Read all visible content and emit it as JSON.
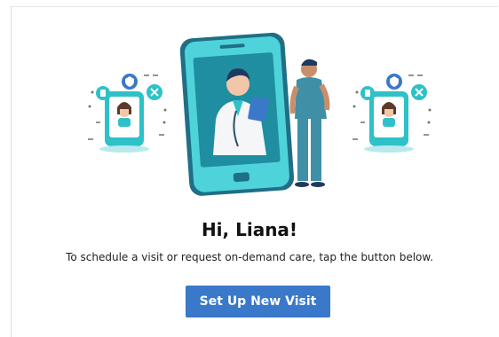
{
  "greeting": "Hi, Liana!",
  "subtitle": "To schedule a visit or request on-demand care, tap the button below.",
  "cta_label": "Set Up New Visit",
  "colors": {
    "accent": "#3a78c9",
    "teal": "#2ec1c8",
    "phone_dark": "#1f6f86",
    "screen": "#2bb8c4"
  },
  "icons": [
    "shield-icon",
    "pill-icon",
    "clipboard-icon",
    "doctor-illustration",
    "patient-phone-illustration"
  ]
}
